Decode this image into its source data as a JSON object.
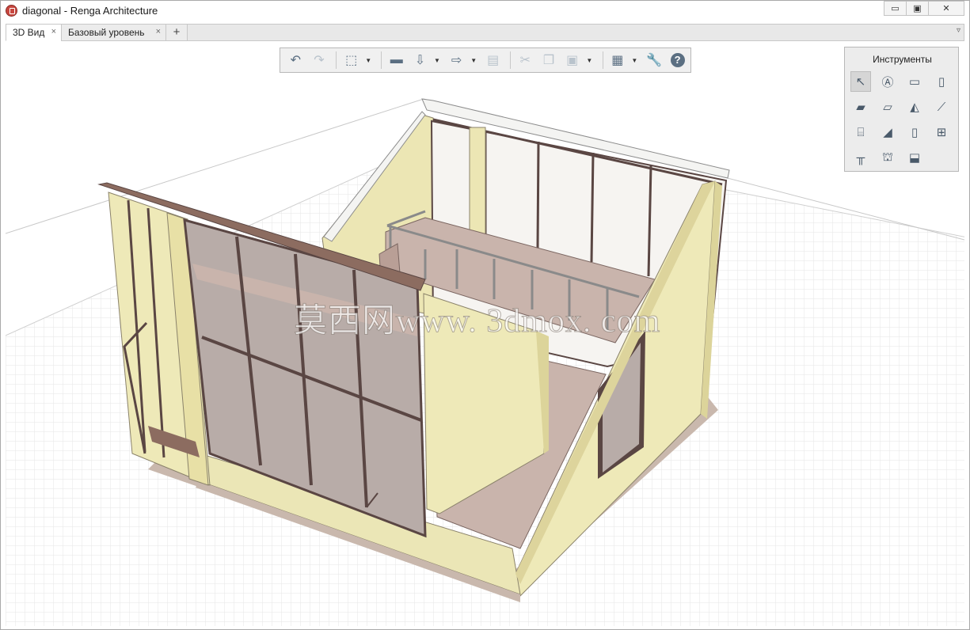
{
  "window": {
    "title": "diagonal - Renga Architecture",
    "min_label": "▭",
    "max_label": "▣",
    "close_label": "✕"
  },
  "tabs": [
    {
      "label": "3D Вид",
      "close": "×"
    },
    {
      "label": "Базовый уровень",
      "close": "×"
    }
  ],
  "tab_add_label": "+",
  "tab_menu_label": "▿",
  "toolbar": {
    "undo": "↶",
    "redo": "↷",
    "view3d": "⬚",
    "open": "▬",
    "import": "⇩",
    "export": "⇨",
    "print": "▤",
    "cut": "✂",
    "copy": "❐",
    "paste": "▣",
    "view_settings": "▦",
    "settings": "🔧",
    "help": "?",
    "dropdown": "▼"
  },
  "tools_panel": {
    "title": "Инструменты",
    "icons": [
      "select-icon",
      "annotation-icon",
      "wall-icon",
      "column-icon",
      "floor-icon",
      "slab-icon",
      "roof-icon",
      "beam-icon",
      "stair-icon",
      "ramp-icon",
      "door-icon",
      "window-icon",
      "railing-icon",
      "equipment-icon",
      "opening-icon"
    ]
  },
  "watermark": "莫西网www. 3dmox. com",
  "colors": {
    "wall": "#eee9b8",
    "wall_shade": "#dcd49a",
    "floor": "#c9b4ac",
    "frame": "#5a4643",
    "beam": "#8c6c60",
    "glass": "#b8aca8",
    "grid": "#e2e2e2"
  }
}
